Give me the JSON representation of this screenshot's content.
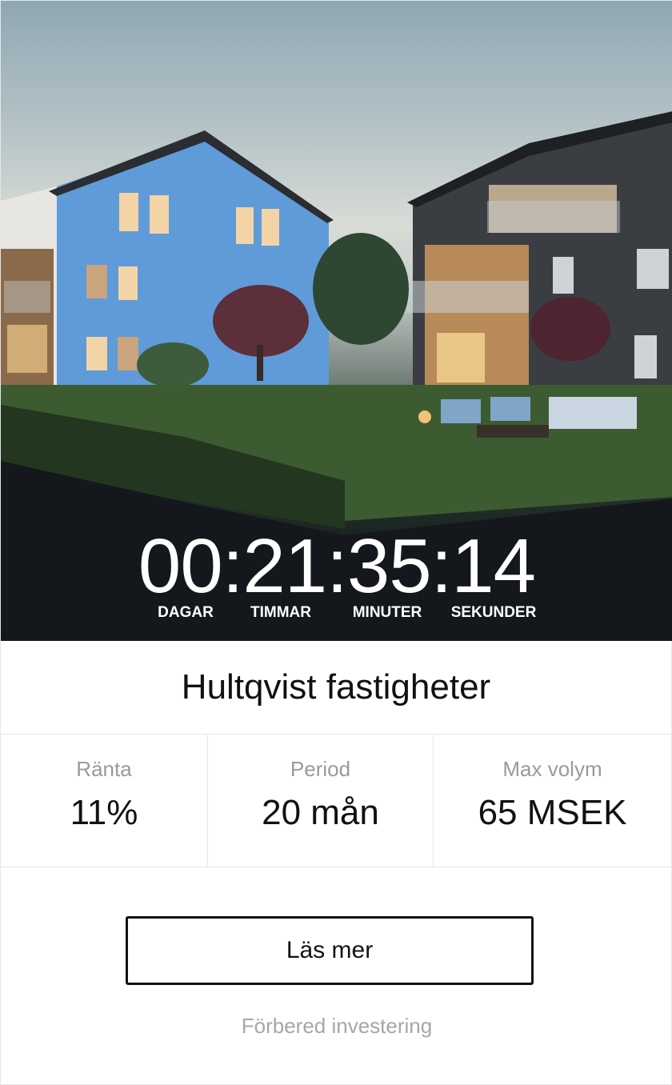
{
  "countdown": {
    "display": "00:21:35:14",
    "labels": [
      "DAGAR",
      "TIMMAR",
      "MINUTER",
      "SEKUNDER"
    ]
  },
  "title": "Hultqvist fastigheter",
  "stats": [
    {
      "label": "Ränta",
      "value": "11%"
    },
    {
      "label": "Period",
      "value": "20 mån"
    },
    {
      "label": "Max volym",
      "value": "65 MSEK"
    }
  ],
  "primary_button": "Läs mer",
  "secondary_link": "Förbered investering",
  "colors": {
    "text": "#111111",
    "muted": "#9a9a9a",
    "border": "#e6e6e6",
    "countdown_text": "#ffffff"
  }
}
